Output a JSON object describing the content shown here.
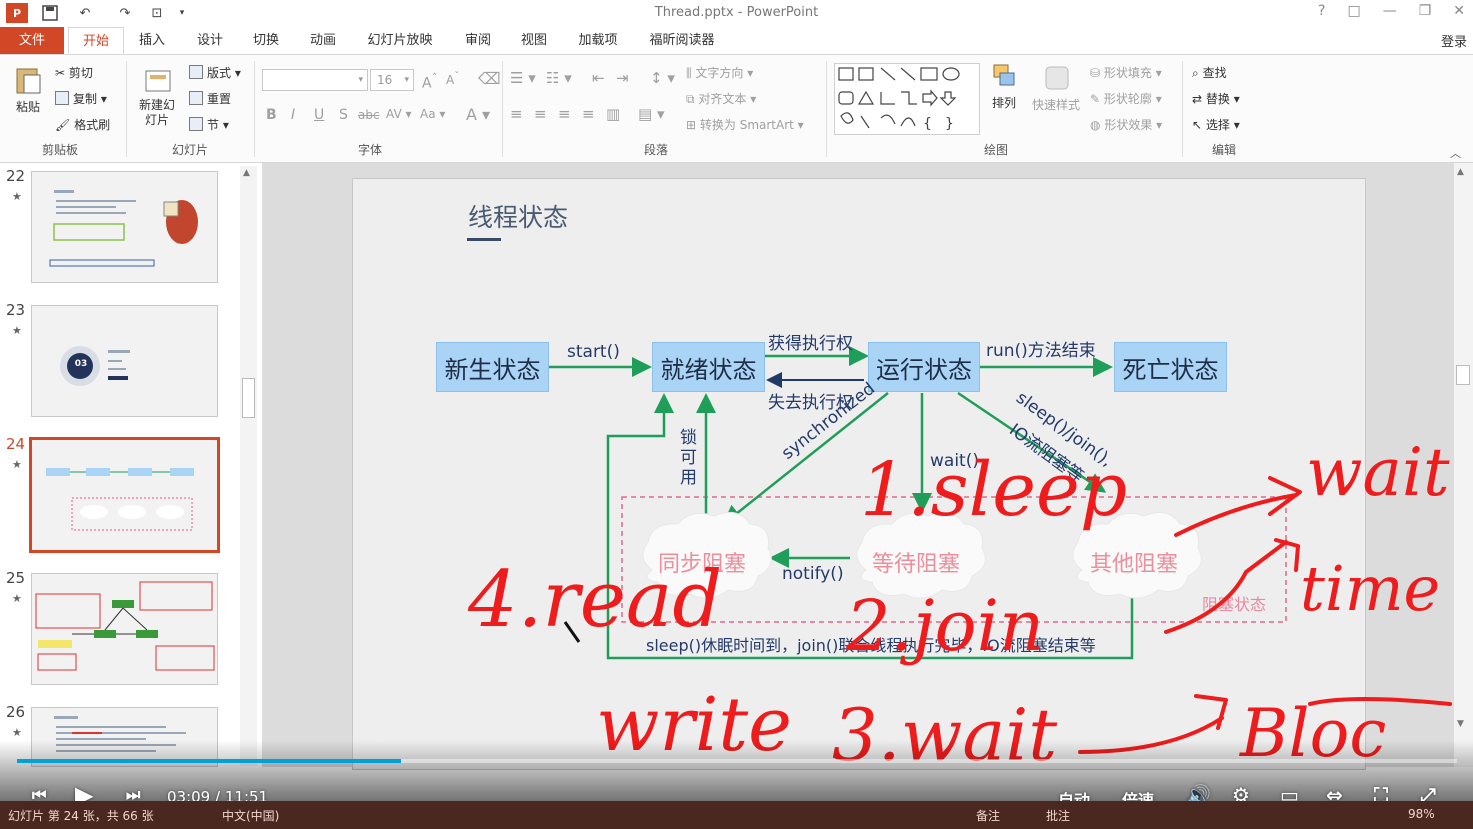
{
  "window": {
    "title": "Thread.pptx - PowerPoint",
    "buttons": [
      "?",
      "□",
      "—",
      "❐",
      "✕"
    ]
  },
  "ribbon": {
    "tabs": [
      "文件",
      "开始",
      "插入",
      "设计",
      "切换",
      "动画",
      "幻灯片放映",
      "审阅",
      "视图",
      "加载项",
      "福昕阅读器"
    ],
    "login": "登录",
    "clipboard": {
      "paste": "粘贴",
      "cut": "剪切",
      "copy": "复制",
      "format_painter": "格式刷",
      "label": "剪贴板"
    },
    "slides": {
      "new_slide": "新建幻灯片",
      "layout": "版式",
      "reset": "重置",
      "section": "节",
      "label": "幻灯片"
    },
    "font": {
      "size": "16",
      "label": "字体"
    },
    "paragraph": {
      "text_direction": "文字方向",
      "align_text": "对齐文本",
      "smartart": "转换为 SmartArt",
      "label": "段落"
    },
    "drawing": {
      "arrange": "排列",
      "quick_styles": "快速样式",
      "shape_fill": "形状填充",
      "shape_outline": "形状轮廓",
      "shape_effects": "形状效果",
      "label": "绘图"
    },
    "editing": {
      "find": "查找",
      "replace": "替换",
      "select": "选择",
      "label": "编辑"
    }
  },
  "slide_panel": {
    "thumbnails": [
      {
        "number": "22",
        "star": "★"
      },
      {
        "number": "23",
        "star": "★"
      },
      {
        "number": "24",
        "star": "★"
      },
      {
        "number": "25",
        "star": "★"
      },
      {
        "number": "26",
        "star": "★"
      }
    ],
    "thumb23_badge": "03"
  },
  "slide": {
    "title": "线程状态",
    "states": {
      "new": "新生状态",
      "ready": "就绪状态",
      "running": "运行状态",
      "dead": "死亡状态"
    },
    "blocked": {
      "sync": "同步阻塞",
      "wait": "等待阻塞",
      "other": "其他阻塞",
      "group": "阻塞状态"
    },
    "edges": {
      "start": "start()",
      "get_cpu": "获得执行权",
      "lose_cpu": "失去执行权",
      "run_end": "run()方法结束",
      "lock_avail": "锁可用",
      "synchronized": "synchronized",
      "wait": "wait()",
      "sleep_join_io": "sleep()/join(),",
      "io_block": "IO流阻塞等",
      "notify": "notify()",
      "back_to_ready": "sleep()休眠时间到，join()联合线程执行完毕，IO流阻塞结束等"
    }
  },
  "handwriting": {
    "line1": "1.sleep",
    "line2": "2.join",
    "line3": "3.wait",
    "line4": "4.read",
    "line5": "write",
    "arrow_target1": "wait",
    "arrow_target2": "time",
    "arrow_target3": "Bloc"
  },
  "video": {
    "current_time": "03:09",
    "separator": "/",
    "duration": "11:51",
    "progress": 0.267,
    "auto": "自动",
    "speed": "倍速"
  },
  "statusbar": {
    "slide_info": "幻灯片 第 24 张，共 66 张",
    "language": "中文(中国)",
    "notes": "备注",
    "comments": "批注",
    "zoom": "98%"
  },
  "colors": {
    "accent": "#d24726",
    "state_fill": "#a9d4f5",
    "arrow": "#1f9e5a",
    "ink": "#ee1c1c",
    "progress": "#00a1d6"
  }
}
